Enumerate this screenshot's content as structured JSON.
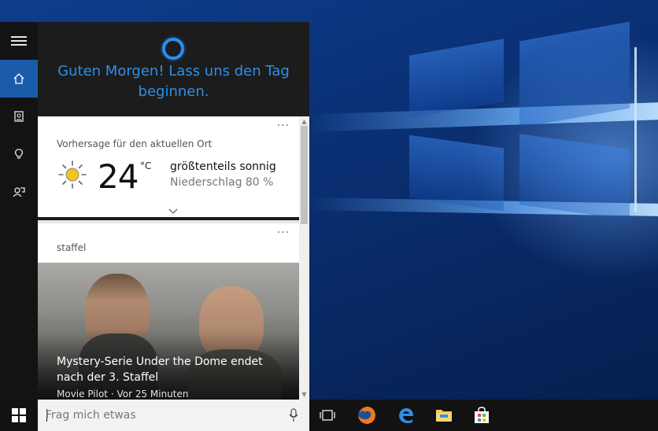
{
  "cortana": {
    "greeting": "Guten Morgen! Lass uns den Tag beginnen.",
    "rail": {
      "items": [
        {
          "name": "menu",
          "icon": "hamburger-icon"
        },
        {
          "name": "home",
          "icon": "home-icon",
          "active": true
        },
        {
          "name": "notebook",
          "icon": "notebook-icon"
        },
        {
          "name": "reminders",
          "icon": "lightbulb-icon"
        },
        {
          "name": "feedback",
          "icon": "feedback-icon"
        }
      ]
    },
    "weather_card": {
      "label": "Vorhersage für den aktuellen Ort",
      "temperature": "24",
      "unit": "°C",
      "condition": "größtenteils sonnig",
      "precipitation": "Niederschlag 80 %",
      "menu": "···",
      "icon": "sun-icon"
    },
    "news_card": {
      "label": "staffel",
      "menu": "···",
      "headline": "Mystery-Serie Under the Dome endet nach der 3. Staffel",
      "meta": "Movie Pilot · Vor 25 Minuten"
    }
  },
  "taskbar": {
    "search_placeholder": "Frag mich etwas",
    "apps": [
      "task-view-icon",
      "firefox-icon",
      "edge-icon",
      "file-explorer-icon",
      "store-icon"
    ]
  },
  "colors": {
    "accent": "#1a5ca8",
    "greeting": "#2f8ee6",
    "taskbar": "#121212"
  }
}
